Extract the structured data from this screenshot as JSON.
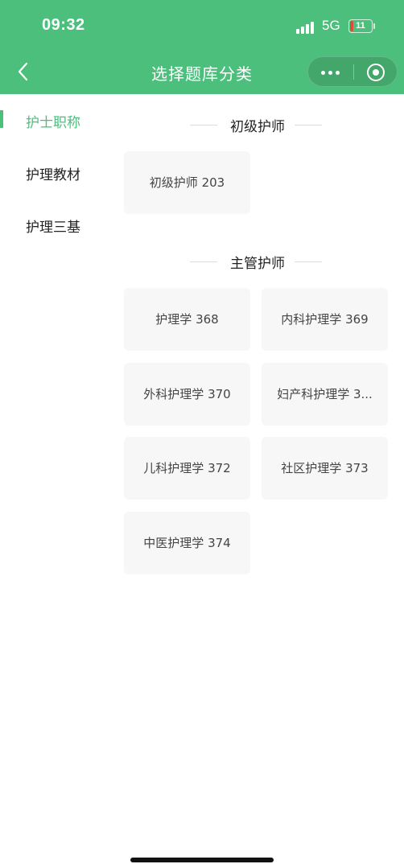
{
  "status_bar": {
    "time": "09:32",
    "network": "5G",
    "battery_level": "11",
    "battery_color": "#e04b3c"
  },
  "nav": {
    "title": "选择题库分类",
    "back_icon": "chevron-left-icon",
    "more_icon": "more-dots-icon",
    "close_icon": "target-close-icon"
  },
  "theme": {
    "accent": "#4dbf7c"
  },
  "sidebar": {
    "items": [
      {
        "label": "护士职称",
        "active": true
      },
      {
        "label": "护理教材",
        "active": false
      },
      {
        "label": "护理三基",
        "active": false
      }
    ]
  },
  "sections": [
    {
      "title": "初级护师",
      "tiles": [
        {
          "label": "初级护师 203"
        }
      ]
    },
    {
      "title": "主管护师",
      "tiles": [
        {
          "label": "护理学 368"
        },
        {
          "label": "内科护理学 369"
        },
        {
          "label": "外科护理学 370"
        },
        {
          "label": "妇产科护理学 3..."
        },
        {
          "label": "儿科护理学 372"
        },
        {
          "label": "社区护理学 373"
        },
        {
          "label": "中医护理学 374"
        }
      ]
    }
  ]
}
